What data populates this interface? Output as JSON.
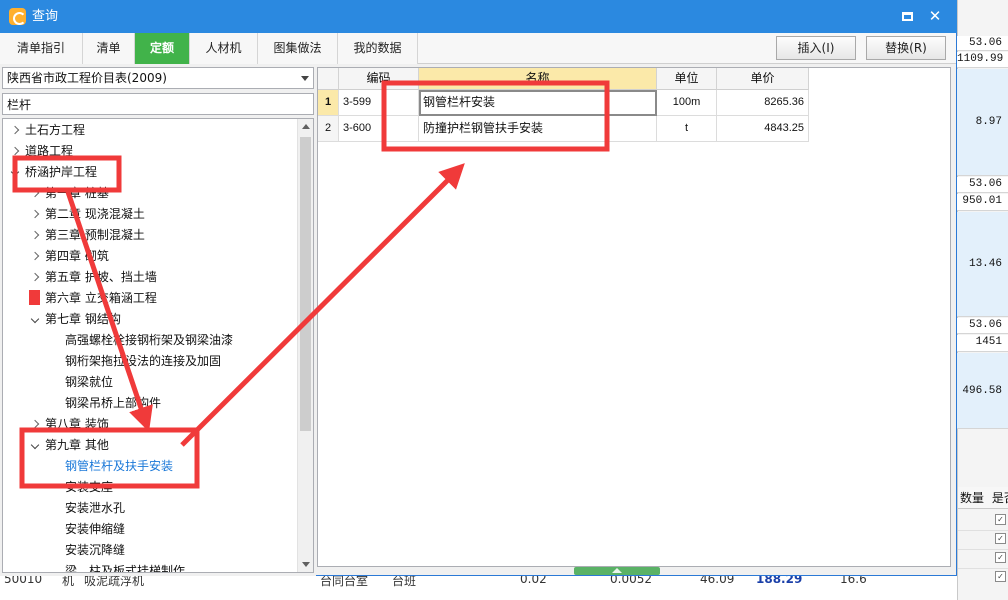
{
  "dialog": {
    "title": "查询",
    "colors": {
      "titlebar": "#2b89e0",
      "active_tab": "#41b34a",
      "annotation": "#f03a3a",
      "selected_text": "#1a78d8"
    }
  },
  "tabs": [
    {
      "label": "清单指引",
      "active": false
    },
    {
      "label": "清单",
      "active": false
    },
    {
      "label": "定额",
      "active": true
    },
    {
      "label": "人材机",
      "active": false
    },
    {
      "label": "图集做法",
      "active": false
    },
    {
      "label": "我的数据",
      "active": false
    }
  ],
  "actions": {
    "insert_label": "插入(I)",
    "replace_label": "替换(R)"
  },
  "left": {
    "library_selected": "陕西省市政工程价目表(2009)",
    "search_value": "栏杆",
    "tree": [
      {
        "label": "土石方工程",
        "level": 0,
        "state": "collapsed"
      },
      {
        "label": "道路工程",
        "level": 0,
        "state": "collapsed"
      },
      {
        "label": "桥涵护岸工程",
        "level": 0,
        "state": "expanded"
      },
      {
        "label": "第一章 桩基",
        "level": 1,
        "state": "collapsed"
      },
      {
        "label": "第二章 现浇混凝土",
        "level": 1,
        "state": "collapsed"
      },
      {
        "label": "第三章 预制混凝土",
        "level": 1,
        "state": "collapsed"
      },
      {
        "label": "第四章 砌筑",
        "level": 1,
        "state": "collapsed"
      },
      {
        "label": "第五章 护坡、挡土墙",
        "level": 1,
        "state": "collapsed"
      },
      {
        "label": "第六章 立交箱涵工程",
        "level": 1,
        "state": "collapsed"
      },
      {
        "label": "第七章 钢结构",
        "level": 1,
        "state": "expanded"
      },
      {
        "label": "高强螺栓栓接钢桁架及钢梁油漆",
        "level": 2,
        "state": "leaf"
      },
      {
        "label": "钢桁架拖拉设法的连接及加固",
        "level": 2,
        "state": "leaf"
      },
      {
        "label": "钢梁就位",
        "level": 2,
        "state": "leaf"
      },
      {
        "label": "钢梁吊桥上部构件",
        "level": 2,
        "state": "leaf"
      },
      {
        "label": "第八章 装饰",
        "level": 1,
        "state": "collapsed"
      },
      {
        "label": "第九章 其他",
        "level": 1,
        "state": "expanded"
      },
      {
        "label": "钢管栏杆及扶手安装",
        "level": 2,
        "state": "leaf",
        "selected": true
      },
      {
        "label": "安装支座",
        "level": 2,
        "state": "leaf"
      },
      {
        "label": "安装泄水孔",
        "level": 2,
        "state": "leaf"
      },
      {
        "label": "安装伸缩缝",
        "level": 2,
        "state": "leaf"
      },
      {
        "label": "安装沉降缝",
        "level": 2,
        "state": "leaf"
      },
      {
        "label": "梁、柱及板式挂梯制作",
        "level": 2,
        "state": "leaf"
      }
    ]
  },
  "grid": {
    "columns": [
      "",
      "编码",
      "名称",
      "单位",
      "单价"
    ],
    "rows": [
      {
        "no": "1",
        "code": "3-599",
        "name": "钢管栏杆安装",
        "unit": "100m",
        "price": "8265.36"
      },
      {
        "no": "2",
        "code": "3-600",
        "name": "防撞护栏钢管扶手安装",
        "unit": "t",
        "price": "4843.25"
      }
    ]
  },
  "background_app": {
    "values": [
      "53.06",
      "1109.99",
      "8.97",
      "53.06",
      "950.01",
      "13.46",
      "53.06",
      "1451",
      "496.58"
    ],
    "header_labels": [
      "数量",
      "是否"
    ],
    "bottom_fragments": [
      "50010",
      "机",
      "吸泥疏浮机",
      "台同台室",
      "台班",
      "0.02",
      "0.0052",
      "46.09",
      "188.29",
      "16.6"
    ]
  }
}
